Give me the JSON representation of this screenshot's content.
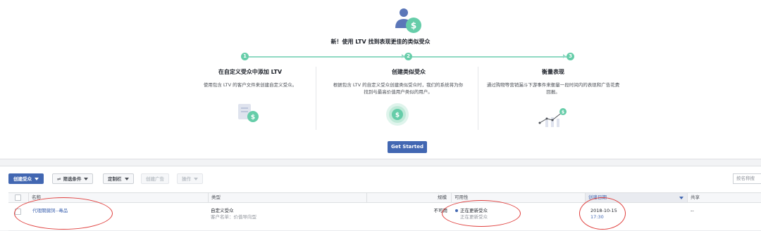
{
  "banner": {
    "headline": "新！使用 LTV 找到表现更佳的类似受众",
    "steps": [
      {
        "number": "1",
        "title": "在自定义受众中添加 LTV",
        "description": "使用包含 LTV 的客户文件来创建自定义受众。"
      },
      {
        "number": "2",
        "title": "创建类似受众",
        "description": "根据包含 LTV 的自定义受众创建类似受众时，我们的系统将为你找到与最高价值用户类似的用户。"
      },
      {
        "number": "3",
        "title": "衡量表现",
        "description": "通过购物等营销漏斗下游事件来衡量一段时间内的表现和广告花费回报。"
      }
    ],
    "cta_label": "Get Started",
    "currency_glyph": "$"
  },
  "toolbar": {
    "create_audience": "创建受众",
    "filter": "筛选条件",
    "columns": "定制栏",
    "create_ad": "创建广告",
    "actions": "操作",
    "search_placeholder": "按名称搜"
  },
  "table": {
    "headers": {
      "name": "名称",
      "type": "类型",
      "size": "规模",
      "availability": "可用性",
      "created": "创建日期",
      "sharing": "共享"
    },
    "rows": [
      {
        "name": "代理關鍵詞--毒品",
        "type": "自定义受众",
        "type_sub": "客户名单：价值导向型",
        "size": "不可用",
        "availability": "正在更新受众",
        "availability_sub": "正在更新受众",
        "created_date": "2018-10-15",
        "created_time": "17:30",
        "sharing": "--"
      }
    ]
  },
  "colors": {
    "accent": "#4267b2",
    "teal": "#66cda9",
    "annotation_red": "#e0403e"
  }
}
